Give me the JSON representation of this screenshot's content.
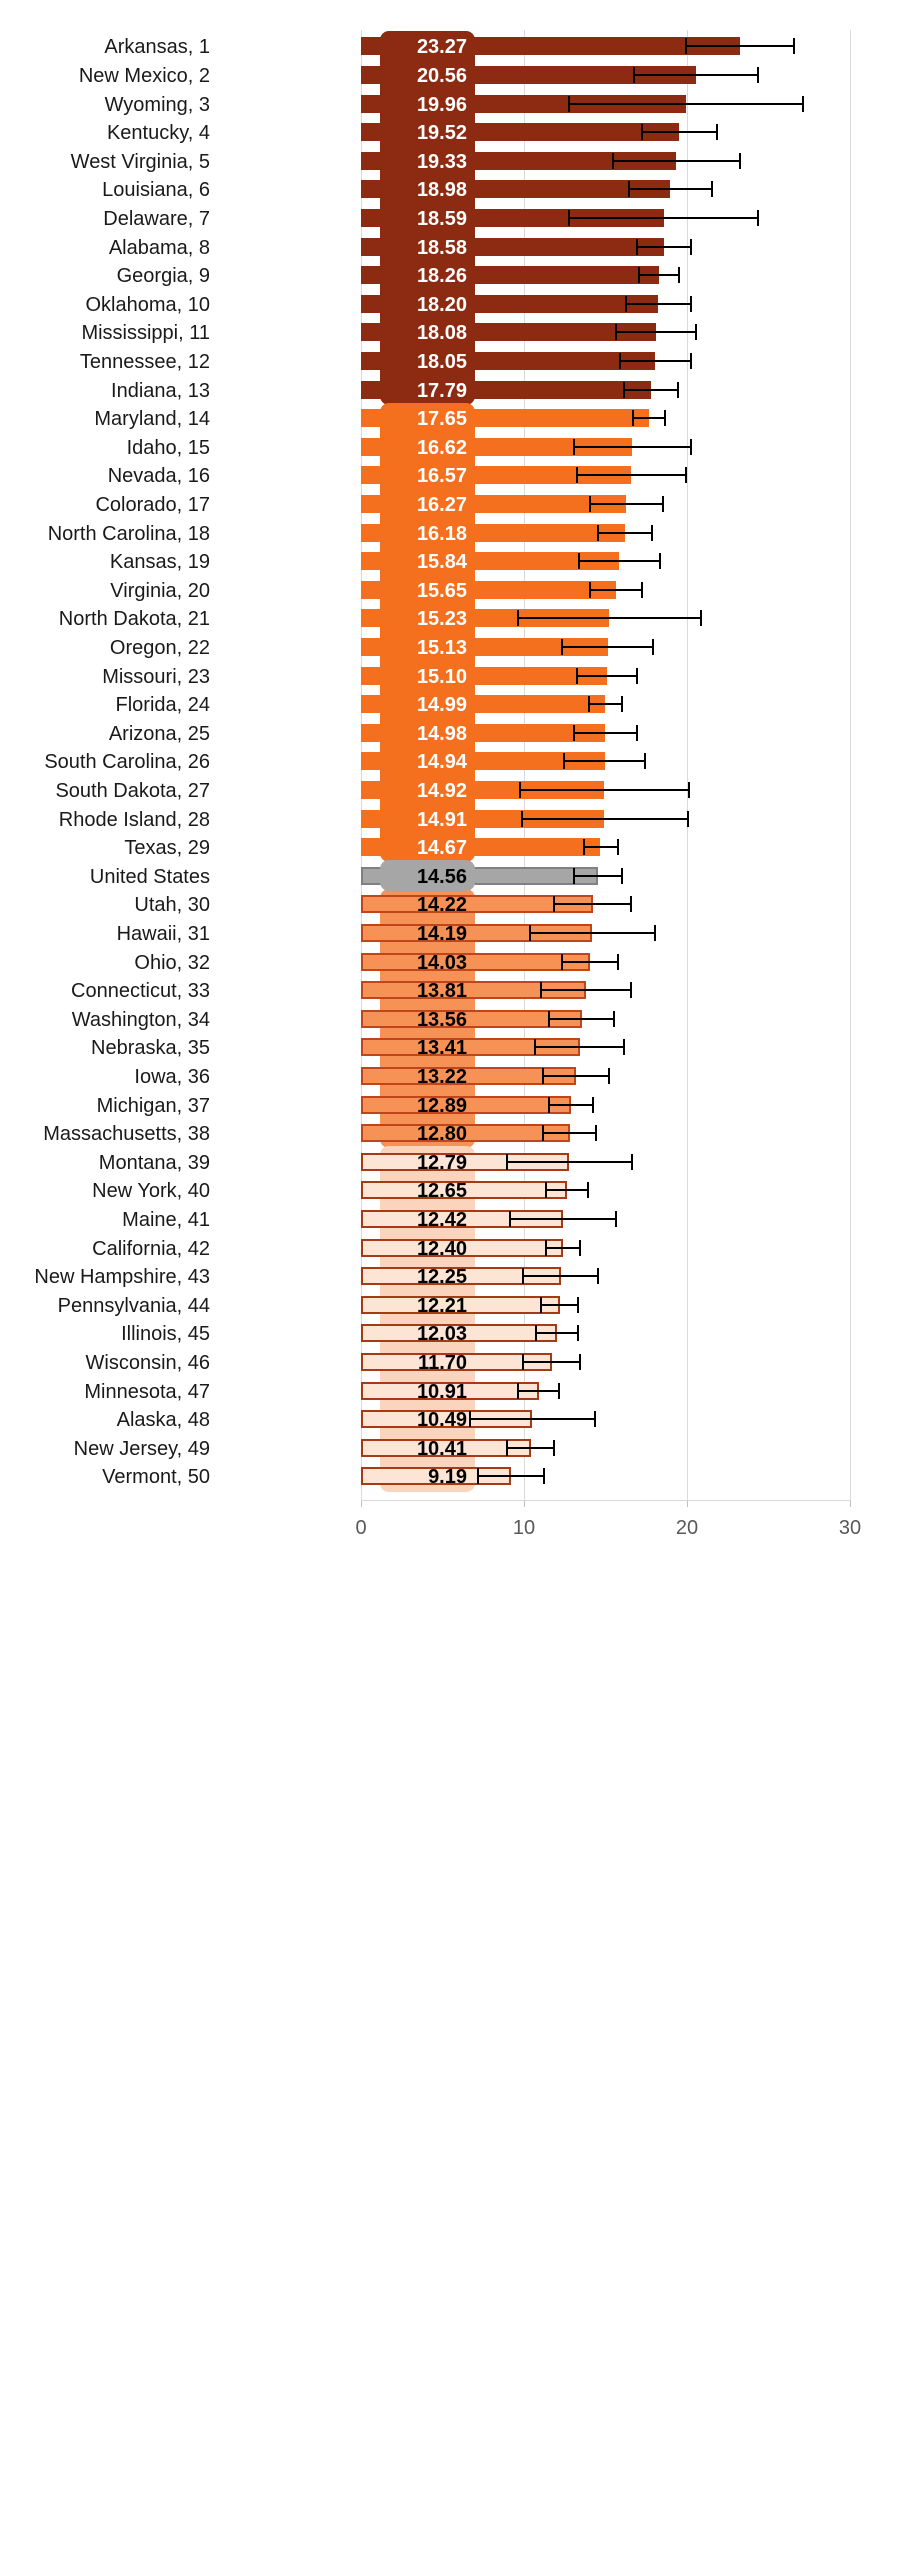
{
  "chart_data": {
    "type": "bar",
    "title": "",
    "xlabel": "",
    "ylabel": "",
    "orientation": "horizontal",
    "xlim": [
      0,
      30
    ],
    "xticks": [
      0,
      10,
      20,
      30
    ],
    "xtick_labels": [
      "0",
      "10",
      "20",
      "30"
    ],
    "grid": true,
    "legend": "none",
    "value_label_format": "2 decimals",
    "error_bars": "95% confidence interval",
    "colors": {
      "group1": "#8C2A12",
      "group2": "#F4701E",
      "group3": "#F79256",
      "group4": "#FBD4BE",
      "group4_bar_fill": "#FDE5D6",
      "bar_outline_dark": "#A63A15",
      "us_fill": "#A6A6A6",
      "us_outline": "#808080",
      "gridline": "#D9D9D9",
      "tick_text": "#595959",
      "label_text": "#1A1A1A"
    },
    "categories": [
      "Arkansas, 1",
      "New Mexico, 2",
      "Wyoming, 3",
      "Kentucky, 4",
      "West Virginia, 5",
      "Louisiana, 6",
      "Delaware, 7",
      "Alabama, 8",
      "Georgia, 9",
      "Oklahoma, 10",
      "Mississippi, 11",
      "Tennessee, 12",
      "Indiana, 13",
      "Maryland, 14",
      "Idaho, 15",
      "Nevada, 16",
      "Colorado, 17",
      "North Carolina, 18",
      "Kansas, 19",
      "Virginia, 20",
      "North Dakota, 21",
      "Oregon, 22",
      "Missouri, 23",
      "Florida, 24",
      "Arizona, 25",
      "South Carolina, 26",
      "South Dakota, 27",
      "Rhode Island, 28",
      "Texas, 29",
      "United States",
      "Utah, 30",
      "Hawaii, 31",
      "Ohio, 32",
      "Connecticut, 33",
      "Washington, 34",
      "Nebraska, 35",
      "Iowa, 36",
      "Michigan, 37",
      "Massachusetts, 38",
      "Montana, 39",
      "New York, 40",
      "Maine, 41",
      "California, 42",
      "New Hampshire, 43",
      "Pennsylvania, 44",
      "Illinois, 45",
      "Wisconsin, 46",
      "Minnesota, 47",
      "Alaska, 48",
      "New Jersey, 49",
      "Vermont, 50"
    ],
    "values": [
      23.27,
      20.56,
      19.96,
      19.52,
      19.33,
      18.98,
      18.59,
      18.58,
      18.26,
      18.2,
      18.08,
      18.05,
      17.79,
      17.65,
      16.62,
      16.57,
      16.27,
      16.18,
      15.84,
      15.65,
      15.23,
      15.13,
      15.1,
      14.99,
      14.98,
      14.94,
      14.92,
      14.91,
      14.67,
      14.56,
      14.22,
      14.19,
      14.03,
      13.81,
      13.56,
      13.41,
      13.22,
      12.89,
      12.8,
      12.79,
      12.65,
      12.42,
      12.4,
      12.25,
      12.21,
      12.03,
      11.7,
      10.91,
      10.49,
      10.41,
      9.19
    ],
    "ci_low": [
      19.9,
      16.7,
      12.7,
      17.2,
      15.4,
      16.4,
      12.7,
      16.9,
      17.0,
      16.2,
      15.6,
      15.8,
      16.1,
      16.6,
      13.0,
      13.2,
      14.0,
      14.5,
      13.3,
      14.0,
      9.6,
      12.3,
      13.2,
      13.9,
      13.0,
      12.4,
      9.7,
      9.8,
      13.6,
      13.0,
      11.8,
      10.3,
      12.3,
      11.0,
      11.5,
      10.6,
      11.1,
      11.5,
      11.1,
      8.9,
      11.3,
      9.1,
      11.3,
      9.9,
      11.0,
      10.7,
      9.9,
      9.6,
      6.6,
      8.9,
      7.1
    ],
    "ci_high": [
      26.6,
      24.4,
      27.2,
      21.9,
      23.3,
      21.6,
      24.4,
      20.3,
      19.6,
      20.3,
      20.6,
      20.3,
      19.5,
      18.7,
      20.3,
      20.0,
      18.6,
      17.9,
      18.4,
      17.3,
      20.9,
      18.0,
      17.0,
      16.1,
      17.0,
      17.5,
      20.2,
      20.1,
      15.8,
      16.1,
      16.6,
      18.1,
      15.8,
      16.6,
      15.6,
      16.2,
      15.3,
      14.3,
      14.5,
      16.7,
      14.0,
      15.7,
      13.5,
      14.6,
      13.4,
      13.4,
      13.5,
      12.2,
      14.4,
      11.9,
      11.3
    ],
    "groups": [
      {
        "name": "tier-1",
        "start": 0,
        "end": 12,
        "fill": "#8C2A12",
        "outline": "#8C2A12",
        "label_box": "#8C2A12",
        "label_text": "#FFFFFF"
      },
      {
        "name": "tier-2",
        "start": 13,
        "end": 28,
        "fill": "#F4701E",
        "outline": "#F4701E",
        "label_box": "#F4701E",
        "label_text": "#FFFFFF"
      },
      {
        "name": "us",
        "start": 29,
        "end": 29,
        "fill": "#A6A6A6",
        "outline": "#808080",
        "label_box": "#A6A6A6",
        "label_text": "#000000"
      },
      {
        "name": "tier-3",
        "start": 30,
        "end": 38,
        "fill": "#F79256",
        "outline": "#C0451B",
        "label_box": "#F79256",
        "label_text": "#000000"
      },
      {
        "name": "tier-4",
        "start": 39,
        "end": 50,
        "fill": "#FDE5D6",
        "outline": "#A63A15",
        "label_box": "#FBD4BE",
        "label_text": "#000000"
      }
    ]
  }
}
